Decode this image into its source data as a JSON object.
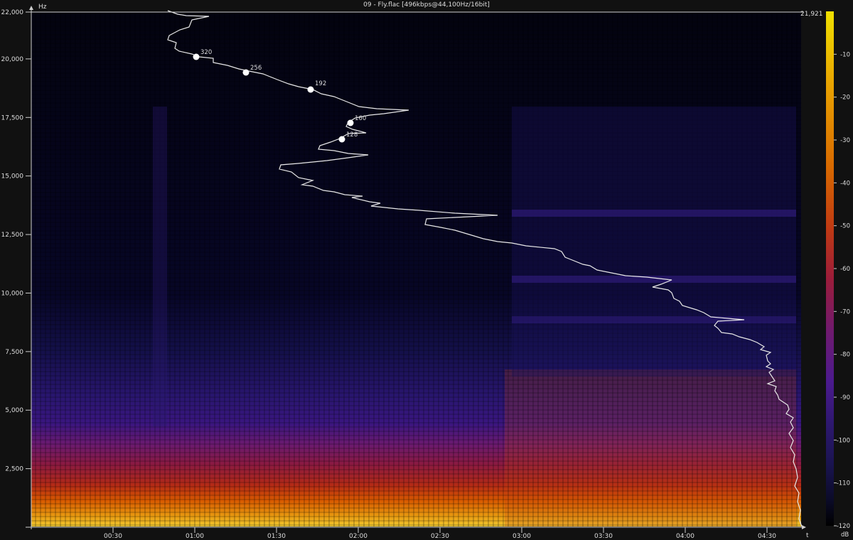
{
  "window": {
    "title": "09 - Fly.flac [496kbps@44,100Hz/16bit]"
  },
  "axes": {
    "y_unit": "Hz",
    "x_unit": "t",
    "y_max_label": "21,921",
    "y_ticks": [
      "22,000",
      "20,000",
      "17,500",
      "15,000",
      "12,500",
      "10,000",
      "7,500",
      "5,000",
      "2,500"
    ],
    "x_ticks": [
      "00:30",
      "01:00",
      "01:30",
      "02:00",
      "02:30",
      "03:00",
      "03:30",
      "04:00",
      "04:30"
    ]
  },
  "colorbar": {
    "unit": "dB",
    "ticks": [
      "-10",
      "-20",
      "-30",
      "-40",
      "-50",
      "-60",
      "-70",
      "-80",
      "-90",
      "-100",
      "-110",
      "-120"
    ],
    "colors": [
      "#e8d800",
      "#e59a00",
      "#d86a00",
      "#c03a12",
      "#9b1c3a",
      "#701a6e",
      "#4b1a8e",
      "#2e1870",
      "#1a1450",
      "#0d0d30",
      "#060615",
      "#000000"
    ]
  },
  "markers": [
    {
      "label": "320"
    },
    {
      "label": "256"
    },
    {
      "label": "192"
    },
    {
      "label": "160"
    },
    {
      "label": "128"
    }
  ],
  "chart_data": {
    "type": "heatmap",
    "title": "09 - Fly.flac [496kbps@44,100Hz/16bit]",
    "xlabel": "t",
    "ylabel": "Hz",
    "ylim": [
      0,
      22000
    ],
    "xlim_seconds": [
      0,
      285
    ],
    "colorbar_range_db": [
      -120,
      0
    ],
    "cutoff_frequency_hz": 21921,
    "bitrate_markers": [
      {
        "label": "320",
        "time": "01:00",
        "hz": 20100
      },
      {
        "label": "256",
        "time": "01:18",
        "hz": 19450
      },
      {
        "label": "192",
        "time": "01:42",
        "hz": 18700
      },
      {
        "label": "160",
        "time": "01:56",
        "hz": 17250
      },
      {
        "label": "128",
        "time": "01:53",
        "hz": 16550
      }
    ]
  }
}
